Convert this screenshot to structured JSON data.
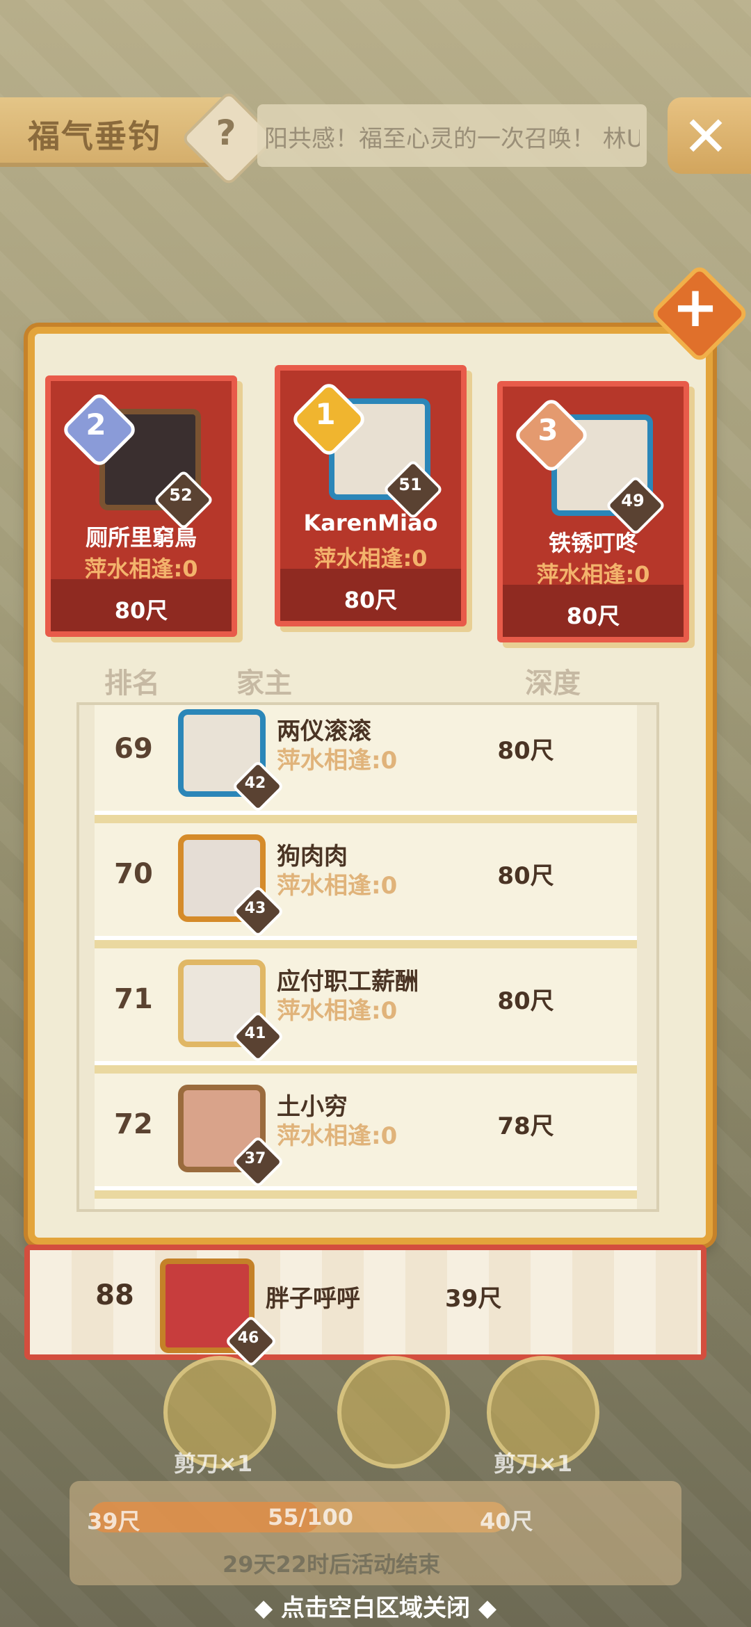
{
  "header": {
    "title": "福气垂钓",
    "help_symbol": "?",
    "marquee": "阳共感！福至心灵的一次召唤！ 林U",
    "close_symbol": "✕"
  },
  "board": {
    "plus_symbol": "+",
    "top3": [
      {
        "rank": "2",
        "level": "52",
        "name": "厕所里窮鳥",
        "sub": "萍水相逢:0",
        "depth": "80尺",
        "badge_color": "#8a9bd8"
      },
      {
        "rank": "1",
        "level": "51",
        "name": "KarenMiao",
        "sub": "萍水相逢:0",
        "depth": "80尺",
        "badge_color": "#f0b52f"
      },
      {
        "rank": "3",
        "level": "49",
        "name": "铁锈叮咚",
        "sub": "萍水相逢:0",
        "depth": "80尺",
        "badge_color": "#e49a6f"
      }
    ],
    "columns": {
      "rank": "排名",
      "owner": "家主",
      "depth": "深度"
    },
    "rows": [
      {
        "rank": "69",
        "level": "42",
        "name": "两仪滚滚",
        "sub": "萍水相逢:0",
        "depth": "80尺"
      },
      {
        "rank": "70",
        "level": "43",
        "name": "狗肉肉",
        "sub": "萍水相逢:0",
        "depth": "80尺"
      },
      {
        "rank": "71",
        "level": "41",
        "name": "应付职工薪酬",
        "sub": "萍水相逢:0",
        "depth": "80尺"
      },
      {
        "rank": "72",
        "level": "37",
        "name": "土小穷",
        "sub": "萍水相逢:0",
        "depth": "78尺"
      }
    ]
  },
  "self": {
    "rank": "88",
    "level": "46",
    "name": "胖子呼呼",
    "depth": "39尺"
  },
  "rewards": [
    {
      "label": "剪刀×1"
    },
    {
      "label": "剪刀×1"
    }
  ],
  "progress": {
    "left": "39尺",
    "value": "55/100",
    "right": "40尺",
    "fraction": 0.55
  },
  "countdown": "29天22时后活动结束",
  "close_hint": "◆ 点击空白区域关闭 ◆",
  "colors": {
    "accent": "#e3a43b",
    "card_red": "#b6372a",
    "self_border": "#d34e3e"
  }
}
